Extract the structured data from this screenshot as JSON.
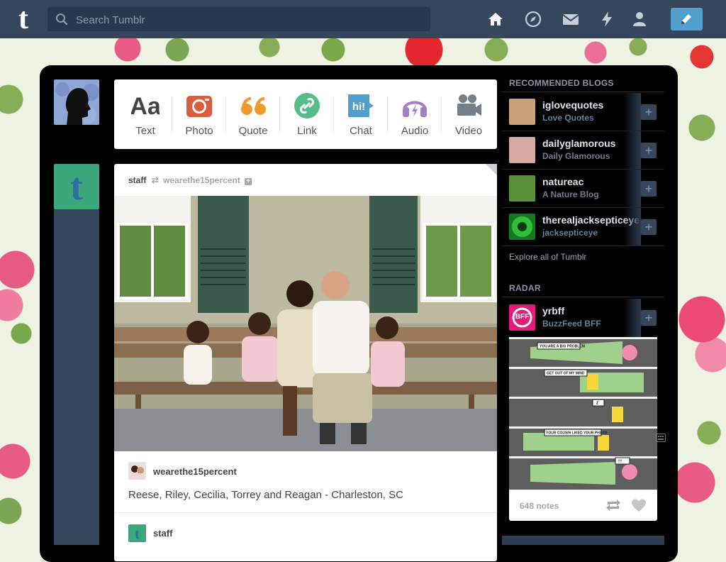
{
  "header": {
    "logo": "t",
    "search_placeholder": "Search Tumblr",
    "nav": [
      "home-icon",
      "explore-icon",
      "inbox-icon",
      "activity-icon",
      "account-icon"
    ],
    "compose": "pencil-icon"
  },
  "post_types": [
    {
      "label": "Text",
      "icon": "text-icon",
      "color": "#444444"
    },
    {
      "label": "Photo",
      "icon": "camera-icon",
      "color": "#d95e40"
    },
    {
      "label": "Quote",
      "icon": "quote-icon",
      "color": "#f2992e"
    },
    {
      "label": "Link",
      "icon": "link-icon",
      "color": "#56bc8a"
    },
    {
      "label": "Chat",
      "icon": "chat-icon",
      "color": "#529ecc"
    },
    {
      "label": "Audio",
      "icon": "headphones-icon",
      "color": "#a77dc2"
    },
    {
      "label": "Video",
      "icon": "video-camera-icon",
      "color": "#748089"
    }
  ],
  "post": {
    "author": "staff",
    "reblogged_from": "wearethe15percent",
    "follow": "+",
    "caption_author": "wearethe15percent",
    "caption": "Reese, Riley, Cecilia, Torrey and Reagan - Charleston, SC",
    "reblogger": "staff"
  },
  "sidebar": {
    "recommended_title": "RECOMMENDED BLOGS",
    "blogs": [
      {
        "name": "iglovequotes",
        "title": "Love Quotes",
        "avatar_color": "#c9a27a"
      },
      {
        "name": "dailyglamorous",
        "title": "Daily Glamorous",
        "avatar_color": "#d6a8a4"
      },
      {
        "name": "natureac",
        "title": "A Nature Blog",
        "avatar_color": "#5c8f3a"
      },
      {
        "name": "therealjacksepticeye",
        "title": "jacksepticeye",
        "avatar_color": "#2fbf3a"
      }
    ],
    "add_label": "+",
    "explore": "Explore all of Tumblr",
    "radar_title": "RADAR",
    "radar": {
      "name": "yrbff",
      "title": "BuzzFeed BFF",
      "avatar_text": "BFF",
      "avatar_color": "#e6197c"
    },
    "notes": "648 notes",
    "comic_captions": [
      "YOU ARE A BIG PROBLEM",
      "GET OUT OF MY MIND",
      "Z",
      "YOUR COUSIN LIKED YOUR PHOTO",
      "!!!"
    ]
  }
}
